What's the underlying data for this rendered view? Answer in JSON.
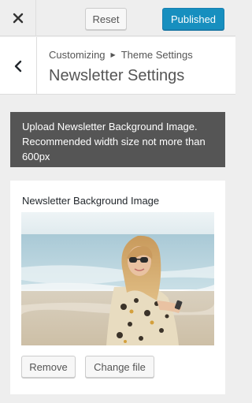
{
  "topbar": {
    "close_icon": "close-icon",
    "reset_label": "Reset",
    "publish_label": "Published"
  },
  "header": {
    "back_icon": "chevron-left-icon",
    "breadcrumb_root": "Customizing",
    "breadcrumb_separator_icon": "triangle-right-icon",
    "breadcrumb_parent": "Theme Settings",
    "title": "Newsletter Settings"
  },
  "notice": {
    "text": "Upload Newsletter Background Image. Recommended width size not more than 600px"
  },
  "control": {
    "title": "Newsletter Background Image",
    "remove_label": "Remove",
    "change_label": "Change file"
  },
  "colors": {
    "publish": "#0085ba",
    "notice_bg": "#555555",
    "panel_bg": "#eeeeee"
  }
}
